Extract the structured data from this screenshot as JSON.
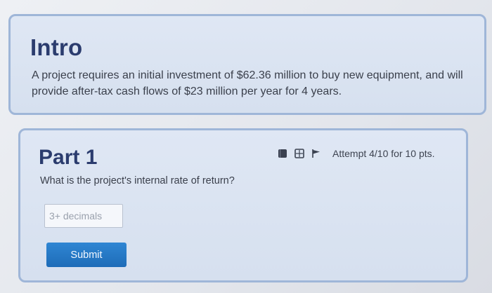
{
  "intro": {
    "title": "Intro",
    "text": "A project requires an initial investment of $62.36 million to buy new equipment, and will provide after-tax cash flows of $23 million per year for 4 years."
  },
  "part1": {
    "title": "Part 1",
    "question": "What is the project's internal rate of return?",
    "input": {
      "placeholder": "3+ decimals",
      "value": ""
    },
    "submit_label": "Submit",
    "attempt_text": "Attempt 4/10 for 10 pts.",
    "toolbar_icons": [
      "book-icon",
      "calculator-icon",
      "flag-icon"
    ]
  },
  "colors": {
    "heading": "#2b3c6e",
    "card_border": "#9fb6d8",
    "card_bg": "#dae3f2",
    "submit_bg": "#2478c6"
  }
}
